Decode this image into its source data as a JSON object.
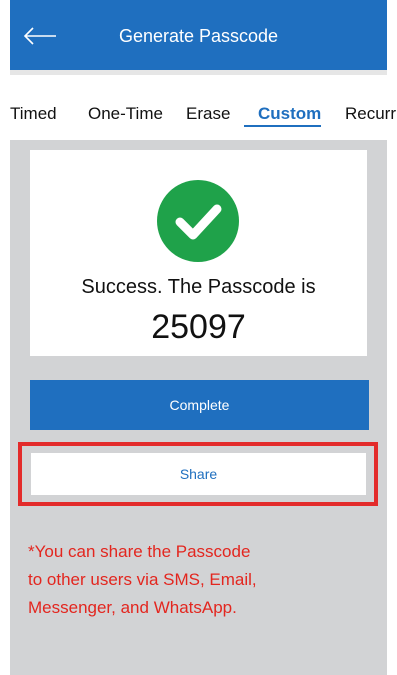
{
  "header": {
    "title": "Generate Passcode",
    "back_icon": "back-arrow-icon"
  },
  "tabs": [
    {
      "label": "Timed",
      "active": false
    },
    {
      "label": "One-Time",
      "active": false
    },
    {
      "label": "Erase",
      "active": false
    },
    {
      "label": "Custom",
      "active": true
    },
    {
      "label": "Recurr",
      "active": false
    }
  ],
  "result": {
    "icon": "check-circle-icon",
    "message": "Success. The Passcode is",
    "passcode": "25097"
  },
  "buttons": {
    "complete_label": "Complete",
    "share_label": "Share"
  },
  "note": {
    "lines": [
      "*You can share the Passcode",
      "to other users via SMS, Email,",
      "Messenger, and WhatsApp."
    ]
  },
  "colors": {
    "primary": "#1f6fbf",
    "success": "#1fa24a",
    "highlight": "#e32b2b",
    "note_text": "#e3261f",
    "panel_bg": "#d2d3d5"
  }
}
